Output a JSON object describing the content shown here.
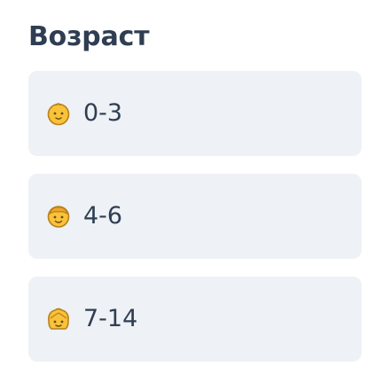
{
  "filter": {
    "title": "Возраст",
    "options": [
      {
        "label": "0-3",
        "icon": "baby-face-icon"
      },
      {
        "label": "4-6",
        "icon": "child-face-icon"
      },
      {
        "label": "7-14",
        "icon": "teen-face-icon"
      }
    ]
  },
  "colors": {
    "text": "#2f3e52",
    "option_background": "#eef1f5",
    "emoji_fill": "#f8c23a",
    "emoji_outline": "#b8801a"
  }
}
